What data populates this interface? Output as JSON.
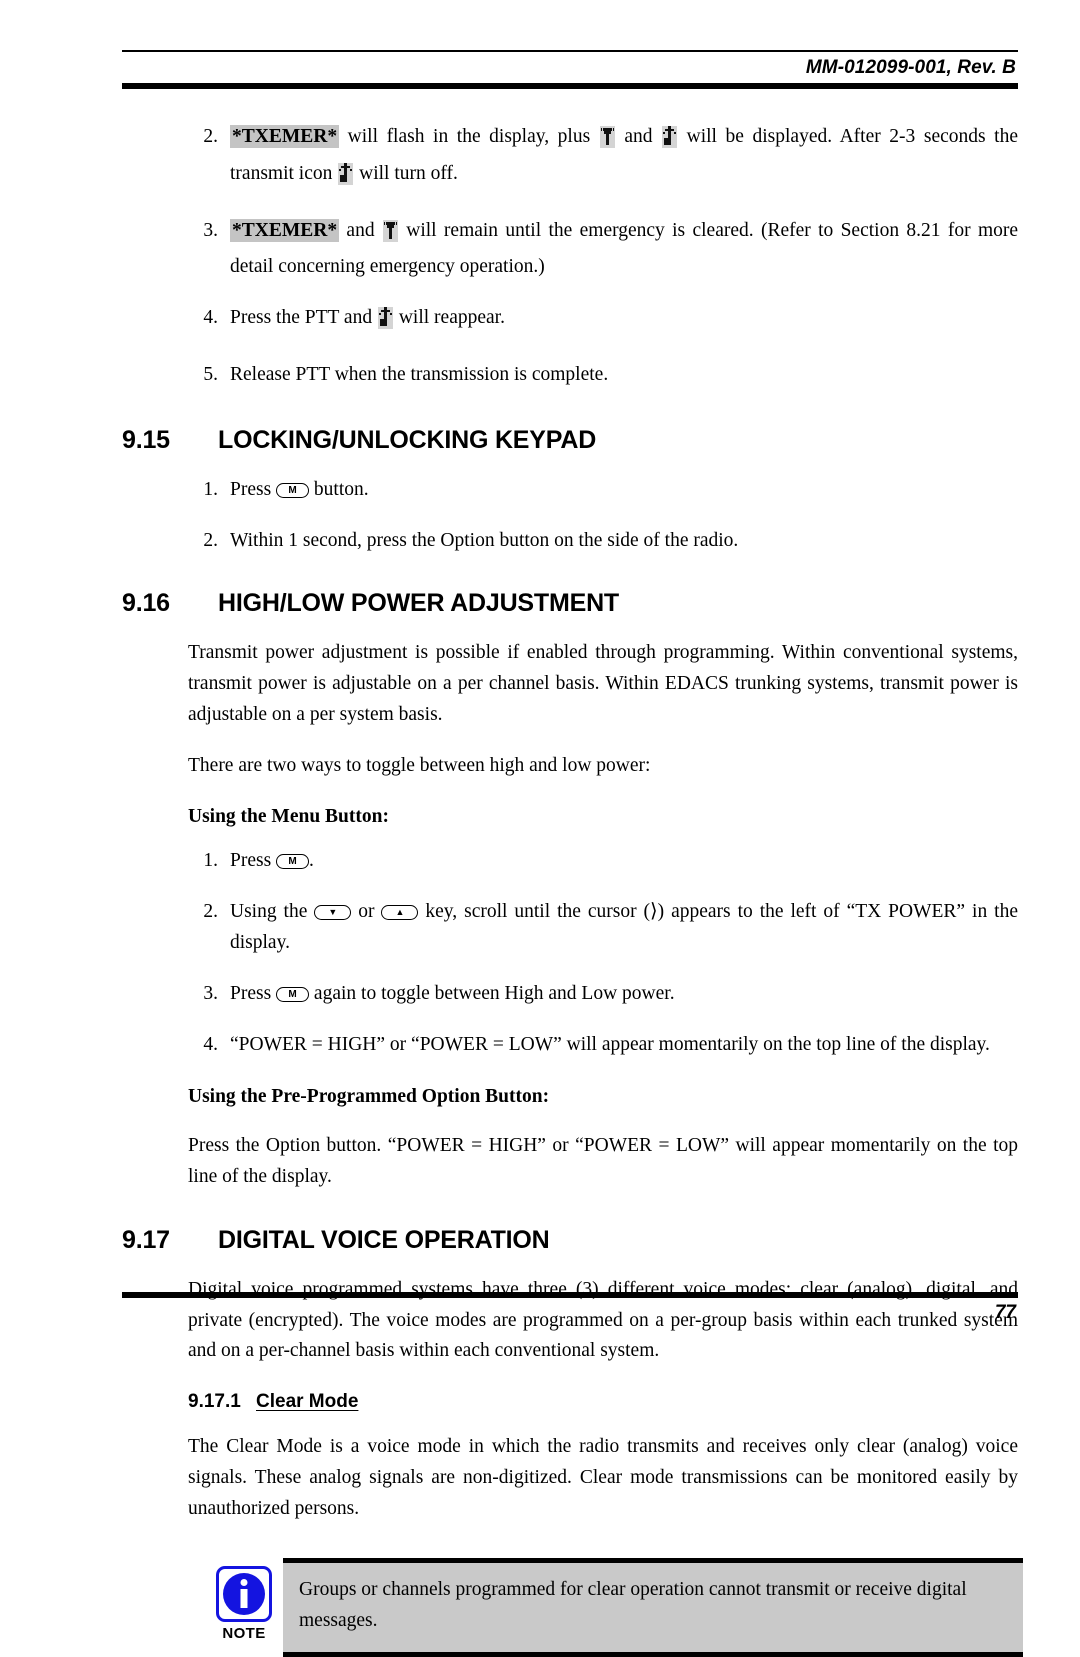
{
  "header": {
    "document_id": "MM-012099-001, Rev. B"
  },
  "footer": {
    "page_number": "77"
  },
  "emergency_steps": {
    "step2": {
      "number": "2.",
      "highlight": "*TXEMER*",
      "text_a": " will flash in the display, plus ",
      "icon_a": "antenna-icon",
      "text_b": " and ",
      "icon_b": "transmit-icon",
      "text_c": " will be displayed. After 2-3 seconds the transmit icon ",
      "icon_c": "transmit-icon",
      "text_d": " will turn off."
    },
    "step3": {
      "number": "3.",
      "highlight": "*TXEMER*",
      "text_a": " and ",
      "icon_a": "antenna-icon",
      "text_b": " will remain until the emergency is cleared.  (Refer to Section 8.21 for more detail concerning emergency operation.)"
    },
    "step4": {
      "number": "4.",
      "text_a": "Press the PTT and ",
      "icon_a": "transmit-icon",
      "text_b": " will reappear."
    },
    "step5": {
      "number": "5.",
      "text_a": "Release PTT when the transmission is complete."
    }
  },
  "section_915": {
    "number": "9.15",
    "title": "LOCKING/UNLOCKING KEYPAD",
    "step1": {
      "number": "1.",
      "text_a": "Press ",
      "key": "M",
      "text_b": " button."
    },
    "step2": {
      "number": "2.",
      "text_a": "Within 1 second, press the Option button on the side of the radio."
    }
  },
  "section_916": {
    "number": "9.16",
    "title": "HIGH/LOW POWER ADJUSTMENT",
    "intro": "Transmit power adjustment is possible if enabled through programming. Within conventional systems, transmit power is adjustable on a per channel basis. Within EDACS trunking systems, transmit power is adjustable on a per system basis.",
    "lead_in": "There are two ways to toggle between high and low power:",
    "menu_button_heading": "Using the Menu Button:",
    "step1": {
      "number": "1.",
      "text_a": "Press ",
      "key": "M",
      "text_b": "."
    },
    "step2": {
      "number": "2.",
      "text_a": "Using the ",
      "key_down": "▼",
      "text_b": " or ",
      "key_up": "▲",
      "text_c": " key, scroll until the cursor (⟩) appears to the left of “TX POWER” in the display."
    },
    "step3": {
      "number": "3.",
      "text_a": "Press ",
      "key": "M",
      "text_b": " again to toggle between High and Low power."
    },
    "step4": {
      "number": "4.",
      "text_a": "“POWER = HIGH” or “POWER = LOW” will appear momentarily on the top line of the display."
    },
    "option_button_heading": "Using the Pre-Programmed Option Button:",
    "option_button_text": "Press the Option button. “POWER = HIGH” or “POWER = LOW” will appear momentarily on the top line of the display."
  },
  "section_917": {
    "number": "9.17",
    "title": "DIGITAL VOICE OPERATION",
    "intro": "Digital voice programmed systems have three (3) different voice modes: clear (analog), digital, and private (encrypted). The voice modes are programmed on a per-group basis within each trunked system and on a per-channel basis within each conventional system.",
    "sub_917_1": {
      "number": "9.17.1",
      "title": "Clear Mode",
      "text": "The Clear Mode is a voice mode in which the radio transmits and receives only clear (analog) voice signals.  These analog signals are non-digitized.  Clear mode transmissions can be monitored easily by unauthorized persons."
    }
  },
  "note": {
    "label": "NOTE",
    "text": "Groups or channels programmed for clear operation cannot transmit or receive digital messages.",
    "icon": "info-icon",
    "accent_color": "#1414e0",
    "background_color": "#c9c9c9"
  }
}
